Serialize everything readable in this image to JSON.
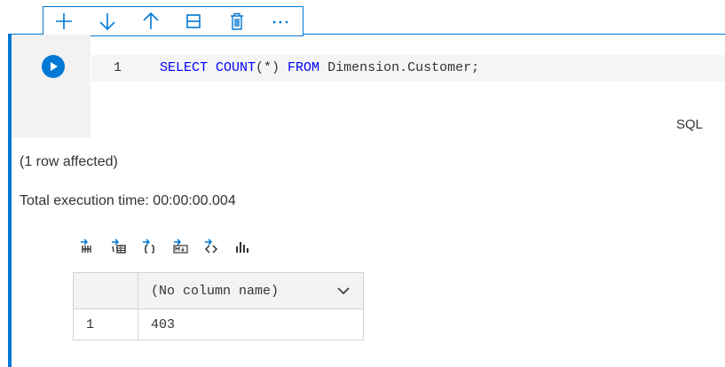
{
  "cell_toolbar": {
    "add_icon": "plus-icon",
    "move_down_icon": "arrow-down-icon",
    "move_up_icon": "arrow-up-icon",
    "split_icon": "split-cell-icon",
    "delete_icon": "trash-icon",
    "more_icon": "more-icon"
  },
  "editor": {
    "line_number": "1",
    "code_tokens": [
      {
        "text": "SELECT COUNT",
        "kw": true
      },
      {
        "text": "(*) ",
        "kw": false
      },
      {
        "text": "FROM",
        "kw": true
      },
      {
        "text": " Dimension.Customer;",
        "kw": false
      }
    ],
    "language": "SQL"
  },
  "output": {
    "rows_affected": "(1 row affected)",
    "execution_time": "Total execution time: 00:00:00.004"
  },
  "result_toolbar": {
    "icons": [
      "save-as-csv-icon",
      "save-as-excel-icon",
      "save-as-json-icon",
      "save-as-markdown-icon",
      "save-as-xml-icon",
      "chart-icon"
    ]
  },
  "result_grid": {
    "columns": [
      "(No column name)"
    ],
    "rows": [
      {
        "row_number": "1",
        "values": [
          "403"
        ]
      }
    ]
  },
  "colors": {
    "accent": "#0078d4",
    "keyword": "#0000ff",
    "gutter": "#f2f2f2"
  }
}
